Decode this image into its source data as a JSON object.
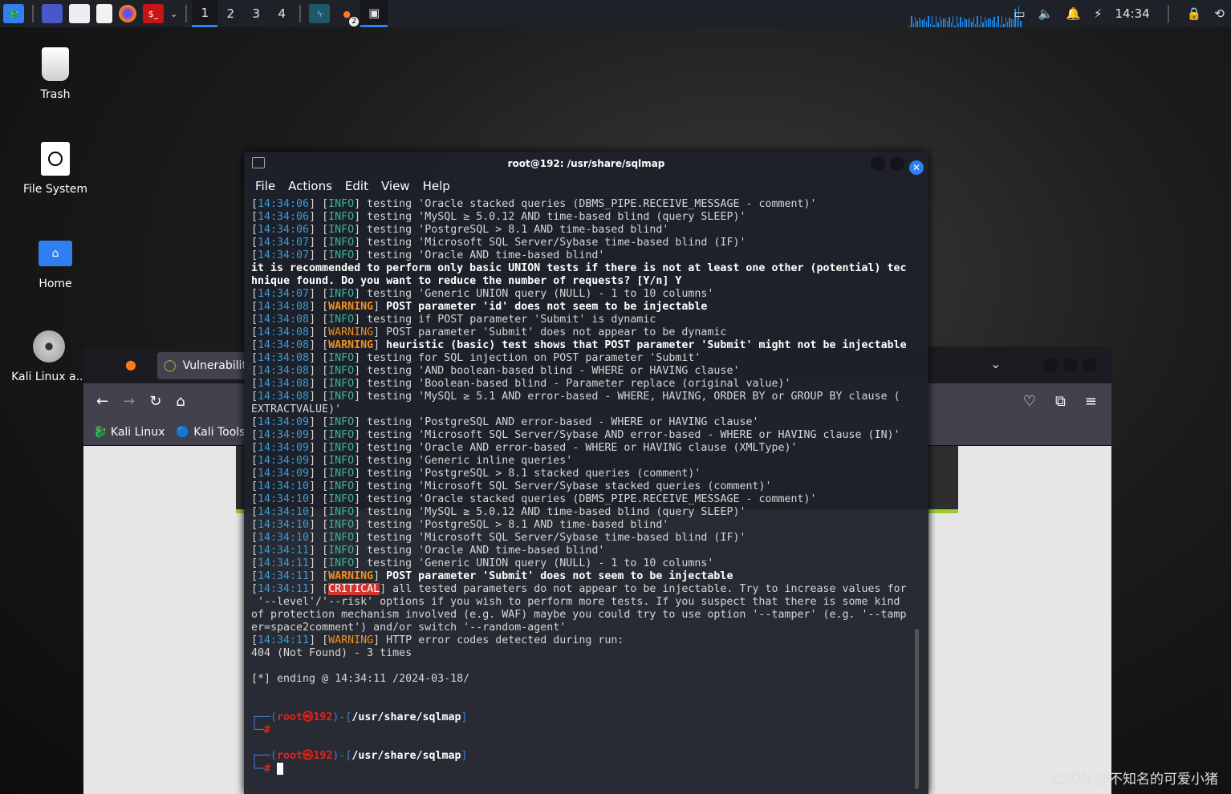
{
  "taskbar": {
    "workspaces": [
      "1",
      "2",
      "3",
      "4"
    ],
    "active_workspace": "1",
    "clock": "14:34",
    "firefox_badge": "2"
  },
  "desktop": {
    "icons": [
      {
        "label": "Trash",
        "icon": "trash-icon"
      },
      {
        "label": "File System",
        "icon": "drive-icon"
      },
      {
        "label": "Home",
        "icon": "home-folder-icon"
      },
      {
        "label": "Kali Linux a...",
        "icon": "disc-icon"
      }
    ]
  },
  "firefox": {
    "tab_title": "Vulnerability",
    "bookmarks": [
      "Kali Linux",
      "Kali Tools"
    ],
    "accent": "#9ccc2c"
  },
  "terminal": {
    "title": "root@192: /usr/share/sqlmap",
    "menu": [
      "File",
      "Actions",
      "Edit",
      "View",
      "Help"
    ],
    "colors": {
      "timestamp": "#3d9ad6",
      "info": "#3fb39a",
      "warning": "#f0901e",
      "critical": "#d23530",
      "prompt_user": "#e3231c"
    },
    "lines": [
      {
        "ts": "14:34:06",
        "lvl": "INFO",
        "msg": "testing 'Oracle stacked queries (DBMS_PIPE.RECEIVE_MESSAGE - comment)'"
      },
      {
        "ts": "14:34:06",
        "lvl": "INFO",
        "msg": "testing 'MySQL ≥ 5.0.12 AND time-based blind (query SLEEP)'"
      },
      {
        "ts": "14:34:06",
        "lvl": "INFO",
        "msg": "testing 'PostgreSQL > 8.1 AND time-based blind'"
      },
      {
        "ts": "14:34:07",
        "lvl": "INFO",
        "msg": "testing 'Microsoft SQL Server/Sybase time-based blind (IF)'"
      },
      {
        "ts": "14:34:07",
        "lvl": "INFO",
        "msg": "testing 'Oracle AND time-based blind'"
      },
      {
        "text": "it is recommended to perform only basic UNION tests if there is not at least one other (potential) tec",
        "bold": true
      },
      {
        "text": "hnique found. Do you want to reduce the number of requests? [Y/n] Y",
        "bold": true
      },
      {
        "ts": "14:34:07",
        "lvl": "INFO",
        "msg": "testing 'Generic UNION query (NULL) - 1 to 10 columns'"
      },
      {
        "ts": "14:34:08",
        "lvl": "WARNING",
        "msg": "POST parameter 'id' does not seem to be injectable",
        "bold": true
      },
      {
        "ts": "14:34:08",
        "lvl": "INFO",
        "msg": "testing if POST parameter 'Submit' is dynamic"
      },
      {
        "ts": "14:34:08",
        "lvl": "WARNING",
        "msg": "POST parameter 'Submit' does not appear to be dynamic"
      },
      {
        "ts": "14:34:08",
        "lvl": "WARNING",
        "msg": "heuristic (basic) test shows that POST parameter 'Submit' might not be injectable",
        "bold": true
      },
      {
        "ts": "14:34:08",
        "lvl": "INFO",
        "msg": "testing for SQL injection on POST parameter 'Submit'"
      },
      {
        "ts": "14:34:08",
        "lvl": "INFO",
        "msg": "testing 'AND boolean-based blind - WHERE or HAVING clause'"
      },
      {
        "ts": "14:34:08",
        "lvl": "INFO",
        "msg": "testing 'Boolean-based blind - Parameter replace (original value)'"
      },
      {
        "ts": "14:34:08",
        "lvl": "INFO",
        "msg": "testing 'MySQL ≥ 5.1 AND error-based - WHERE, HAVING, ORDER BY or GROUP BY clause ("
      },
      {
        "text": "EXTRACTVALUE)'"
      },
      {
        "ts": "14:34:09",
        "lvl": "INFO",
        "msg": "testing 'PostgreSQL AND error-based - WHERE or HAVING clause'"
      },
      {
        "ts": "14:34:09",
        "lvl": "INFO",
        "msg": "testing 'Microsoft SQL Server/Sybase AND error-based - WHERE or HAVING clause (IN)'"
      },
      {
        "ts": "14:34:09",
        "lvl": "INFO",
        "msg": "testing 'Oracle AND error-based - WHERE or HAVING clause (XMLType)'"
      },
      {
        "ts": "14:34:09",
        "lvl": "INFO",
        "msg": "testing 'Generic inline queries'"
      },
      {
        "ts": "14:34:09",
        "lvl": "INFO",
        "msg": "testing 'PostgreSQL > 8.1 stacked queries (comment)'"
      },
      {
        "ts": "14:34:10",
        "lvl": "INFO",
        "msg": "testing 'Microsoft SQL Server/Sybase stacked queries (comment)'"
      },
      {
        "ts": "14:34:10",
        "lvl": "INFO",
        "msg": "testing 'Oracle stacked queries (DBMS_PIPE.RECEIVE_MESSAGE - comment)'"
      },
      {
        "ts": "14:34:10",
        "lvl": "INFO",
        "msg": "testing 'MySQL ≥ 5.0.12 AND time-based blind (query SLEEP)'"
      },
      {
        "ts": "14:34:10",
        "lvl": "INFO",
        "msg": "testing 'PostgreSQL > 8.1 AND time-based blind'"
      },
      {
        "ts": "14:34:10",
        "lvl": "INFO",
        "msg": "testing 'Microsoft SQL Server/Sybase time-based blind (IF)'"
      },
      {
        "ts": "14:34:11",
        "lvl": "INFO",
        "msg": "testing 'Oracle AND time-based blind'"
      },
      {
        "ts": "14:34:11",
        "lvl": "INFO",
        "msg": "testing 'Generic UNION query (NULL) - 1 to 10 columns'"
      },
      {
        "ts": "14:34:11",
        "lvl": "WARNING",
        "msg": "POST parameter 'Submit' does not seem to be injectable",
        "bold": true
      },
      {
        "ts": "14:34:11",
        "lvl": "CRITICAL",
        "msg": "all tested parameters do not appear to be injectable. Try to increase values for"
      },
      {
        "text": " '--level'/'--risk' options if you wish to perform more tests. If you suspect that there is some kind"
      },
      {
        "text": "of protection mechanism involved (e.g. WAF) maybe you could try to use option '--tamper' (e.g. '--tamp"
      },
      {
        "text": "er=space2comment') and/or switch '--random-agent'"
      },
      {
        "ts": "14:34:11",
        "lvl": "WARNING",
        "msg": "HTTP error codes detected during run:"
      },
      {
        "text": "404 (Not Found) - 3 times"
      },
      {
        "text": ""
      },
      {
        "text": "[*] ending @ 14:34:11 /2024-03-18/"
      },
      {
        "text": ""
      },
      {
        "text": ""
      },
      {
        "prompt": true,
        "user": "root㉿192",
        "path": "/usr/share/sqlmap"
      },
      {
        "hash": true
      },
      {
        "text": ""
      },
      {
        "prompt": true,
        "user": "root㉿192",
        "path": "/usr/share/sqlmap"
      },
      {
        "hash": true,
        "cursor": true
      }
    ]
  },
  "watermark": "CSDN @不知名的可爱小猪"
}
